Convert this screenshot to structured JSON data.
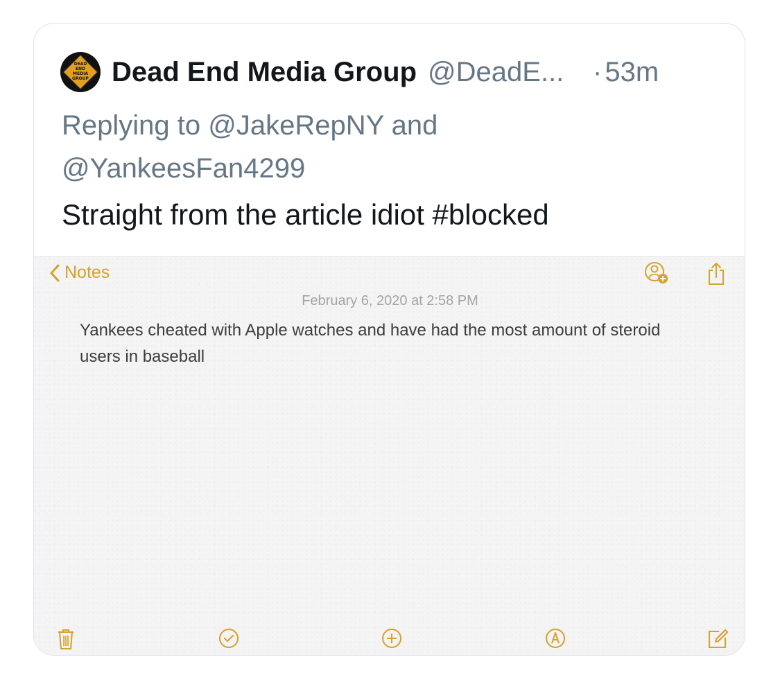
{
  "tweet": {
    "avatar_text": [
      "DEAD",
      "END",
      "MEDIA",
      "GROUP"
    ],
    "display_name": "Dead End Media Group",
    "handle": "@DeadE...",
    "separator": "·",
    "time_ago": "53m",
    "replying_to_line1": "Replying to @JakeRepNY and",
    "replying_to_line2": "@YankeesFan4299",
    "text": "Straight from the article idiot #blocked"
  },
  "notes_screenshot": {
    "back_label": "Notes",
    "date": "February 6, 2020 at 2:58 PM",
    "body": "Yankees cheated with Apple watches and have had the most amount of steroid users in baseball",
    "accent_color": "#d8a128",
    "top_icons": [
      "add-person-icon",
      "share-icon"
    ],
    "bottom_icons": [
      "trash-icon",
      "checklist-icon",
      "add-icon",
      "markup-icon",
      "compose-icon"
    ]
  }
}
